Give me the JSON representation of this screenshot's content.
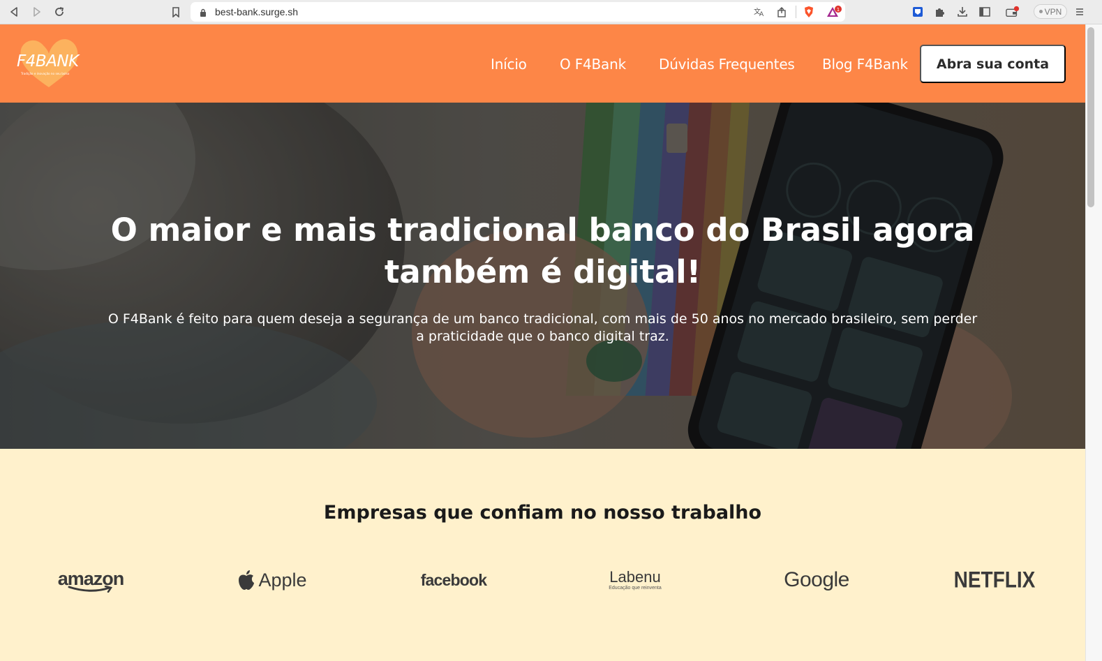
{
  "browser": {
    "url": "best-bank.surge.sh",
    "vpn_label": "VPN",
    "alert_badge": "1",
    "nav_icons": [
      "back-icon",
      "forward-icon",
      "reload-icon",
      "bookmark-icon"
    ],
    "url_icons": [
      "lock-icon",
      "translate-icon",
      "share-icon"
    ]
  },
  "header": {
    "logo_text": "F4BANK",
    "logo_tagline": "Tradição e inovação no seu bolso",
    "nav": [
      {
        "label": "Início"
      },
      {
        "label": "O F4Bank"
      },
      {
        "label": "Dúvidas Frequentes"
      },
      {
        "label": "Blog F4Bank"
      }
    ],
    "cta_label": "Abra sua conta"
  },
  "hero": {
    "title": "O maior e mais tradicional banco do Brasil agora também é digital!",
    "text": "O F4Bank é feito para quem deseja a segurança de um banco tradicional, com mais de 50 anos no mercado brasileiro, sem perder a praticidade que o banco digital traz."
  },
  "partners": {
    "title": "Empresas que confiam no nosso trabalho",
    "brands": {
      "amazon": "amazon",
      "apple": "Apple",
      "facebook": "facebook",
      "labenu": "Labenu",
      "labenu_tagline": "Educação que reinventa",
      "google": "Google",
      "netflix": "NETFLIX"
    }
  },
  "colors": {
    "brand_orange": "#fd8647",
    "partners_bg": "#fff1cc"
  }
}
